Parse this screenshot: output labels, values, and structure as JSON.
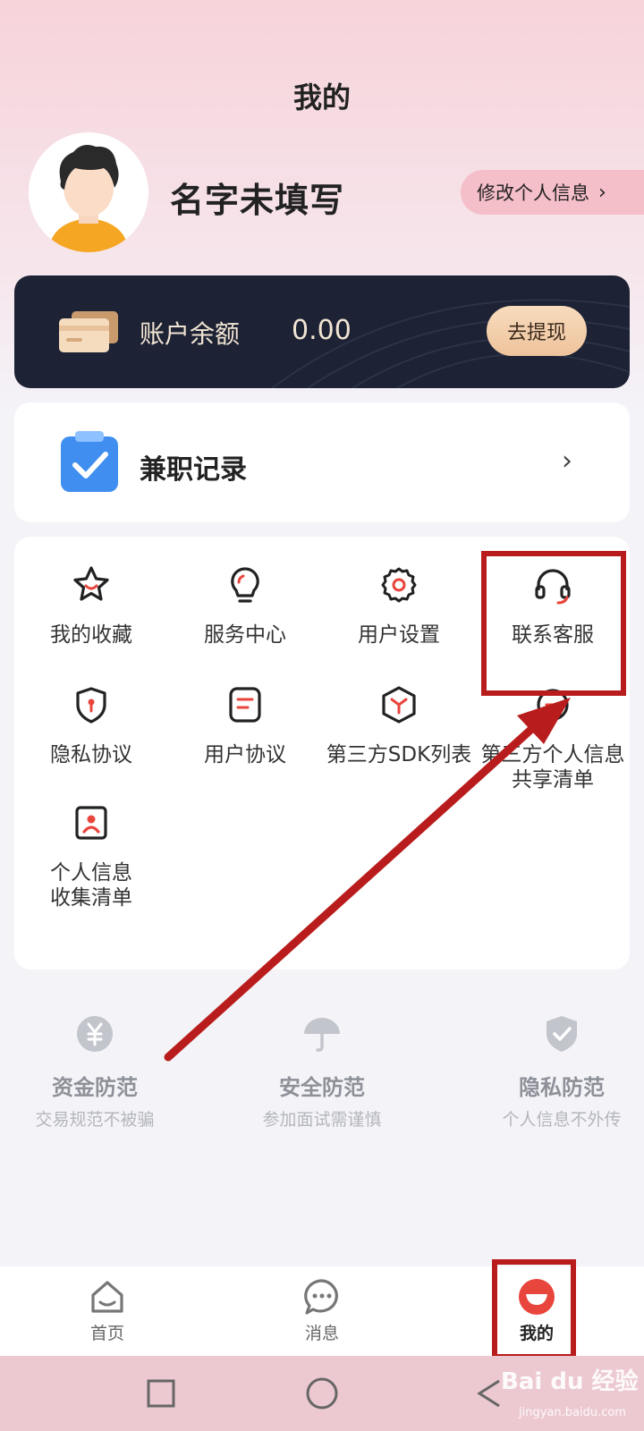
{
  "header": {
    "title": "我的"
  },
  "profile": {
    "name": "名字未填写",
    "edit_label": "修改个人信息",
    "edit_chevron": "›"
  },
  "balance": {
    "label": "账户余额",
    "value": "0.00",
    "withdraw_label": "去提现"
  },
  "record": {
    "label": "兼职记录",
    "chevron": "›"
  },
  "menu": {
    "items": [
      {
        "label": "我的收藏",
        "icon": "star-icon"
      },
      {
        "label": "服务中心",
        "icon": "bulb-icon"
      },
      {
        "label": "用户设置",
        "icon": "gear-icon"
      },
      {
        "label": "联系客服",
        "icon": "headset-icon"
      },
      {
        "label": "隐私协议",
        "icon": "shield-lock-icon"
      },
      {
        "label": "用户协议",
        "icon": "document-icon"
      },
      {
        "label": "第三方SDK列表",
        "icon": "cube-icon"
      },
      {
        "label": "第三方个人信息",
        "label2": "共享清单",
        "icon": "share-list-icon"
      },
      {
        "label": "个人信息",
        "label2": "收集清单",
        "icon": "person-card-icon"
      }
    ]
  },
  "safety": {
    "items": [
      {
        "title": "资金防范",
        "subtitle": "交易规范不被骗",
        "icon": "yen-icon"
      },
      {
        "title": "安全防范",
        "subtitle": "参加面试需谨慎",
        "icon": "umbrella-icon"
      },
      {
        "title": "隐私防范",
        "subtitle": "个人信息不外传",
        "icon": "shield-check-icon"
      }
    ]
  },
  "tabbar": {
    "tabs": [
      {
        "label": "首页",
        "icon": "home-icon"
      },
      {
        "label": "消息",
        "icon": "message-icon"
      },
      {
        "label": "我的",
        "icon": "profile-icon",
        "active": true
      }
    ]
  },
  "watermark": {
    "text": "Bai du 经验",
    "sub": "jingyan.baidu.com"
  },
  "colors": {
    "accent": "#e8453c",
    "highlight": "#b91c1c",
    "card_dark": "#1d2234"
  }
}
